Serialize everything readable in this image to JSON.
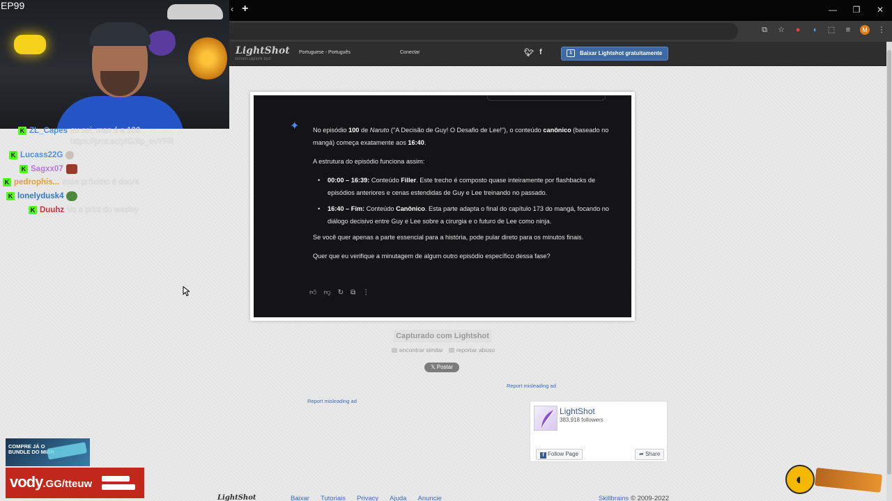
{
  "stream": {
    "episode_label": "EP99",
    "chat": [
      {
        "user": "ZL_Capes",
        "message": "eu sei, mas é a 100",
        "user_color": "#4f8fe0"
      },
      {
        "user": "",
        "message": "https://prnt.sc/pIG3Ip_evYFR",
        "user_color": "#4f8fe0"
      },
      {
        "user": "Lucass22G",
        "message": "",
        "user_color": "#4f8fe0"
      },
      {
        "user": "Sagxx07",
        "message": "",
        "user_color": "#b57ad8"
      },
      {
        "user": "pedrophis...",
        "message": "esse próximo é daora",
        "user_color": "#e0a030"
      },
      {
        "user": "lonelydusk4",
        "message": "",
        "user_color": "#2f78d8"
      },
      {
        "user": "Duuhz",
        "message": "Vo a print do wesley",
        "user_color": "#d0303e"
      }
    ],
    "promo_text": "COMPRE JÁ O BUNDLE DO MIBR",
    "vody_brand": "vody",
    "vody_domain": ".GG",
    "vody_handle": "/tteuw"
  },
  "browser": {
    "new_tab": "+",
    "window_controls": [
      "—",
      "❐",
      "✕"
    ]
  },
  "lightshot": {
    "logo": "LightShot",
    "logo_sub": "screen capture tool",
    "language": "Portuguese - Português",
    "connect": "Conectar",
    "download_button": "Baixar Lightshot gratuitamente",
    "social": [
      "twitter-icon",
      "facebook-icon"
    ]
  },
  "screenshot": {
    "p1_pre": "No episódio ",
    "p1_num": "100",
    "p1_de": " de ",
    "p1_show": "Naruto",
    "p1_title": " (\"A Decisão de Guy! O Desafio de Lee!\"), o conteúdo ",
    "p1_canon": "canônico",
    "p1_rest": " (baseado no mangá) começa exatamente aos ",
    "p1_time": "16:40",
    "p1_end": ".",
    "p2": "A estrutura do episódio funciona assim:",
    "li1_time": "00:00 – 16:39:",
    "li1_a": " Conteúdo ",
    "li1_kind": "Filler",
    "li1_b": ". Este trecho é composto quase inteiramente por flashbacks de episódios anteriores e cenas estendidas de Guy e Lee treinando no passado.",
    "li2_time": "16:40 – Fim:",
    "li2_a": " Conteúdo ",
    "li2_kind": "Canônico",
    "li2_b": ". Esta parte adapta o final do capítulo 173 do mangá, focando no diálogo decisivo entre Guy e Lee sobre a cirurgia e o futuro de Lee como ninja.",
    "p3": "Se você quer apenas a parte essencial para a história, pode pular direto para os minutos finais.",
    "p4": "Quer que eu verifique a minutagem de algum outro episódio específico dessa fase?"
  },
  "below": {
    "captured": "Capturado com Lightshot",
    "find_similar": "encontrar similar",
    "report_abuse": "reportar abuso",
    "post_button": "Postar",
    "ad_link_1": "Report misleading ad",
    "ad_link_2": "Report misleading ad"
  },
  "facebook": {
    "name": "LightShot",
    "followers": "383,918 followers",
    "follow": "Follow Page",
    "share": "Share"
  },
  "footer": {
    "logo": "LightShot",
    "links": [
      "Baixar",
      "Tutoriais",
      "Privacy",
      "Ajuda",
      "Anuncie"
    ],
    "company": "Skillbrains",
    "copyright": "© 2009-2022"
  }
}
